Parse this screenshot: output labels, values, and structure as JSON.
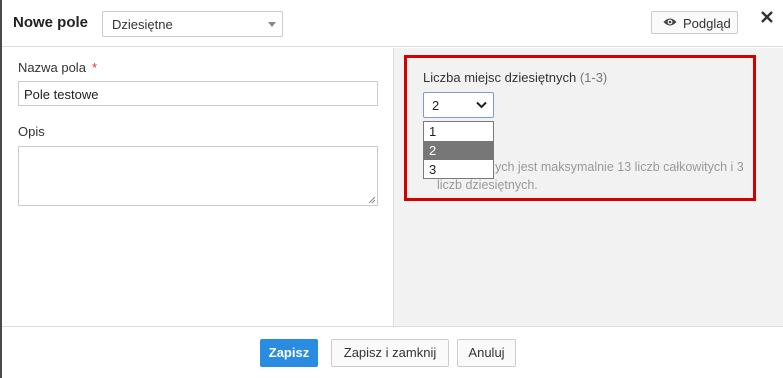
{
  "header": {
    "title": "Nowe pole",
    "field_type": "Dziesiętne",
    "preview_label": "Podgląd"
  },
  "left": {
    "name_label": "Nazwa pola",
    "required_mark": "*",
    "name_value": "Pole testowe",
    "description_label": "Opis",
    "description_value": ""
  },
  "right": {
    "decimal_label": "Liczba miejsc dziesiętnych",
    "decimal_range": "(1-3)",
    "decimal_selected": "2",
    "decimal_options": [
      "1",
      "2",
      "3"
    ],
    "info_line1": "ych jest maksymalnie 13 liczb całkowitych i 3",
    "info_line2": "liczb dziesiętnych.",
    "highlight_color": "#d40000"
  },
  "footer": {
    "save": "Zapisz",
    "save_close": "Zapisz i zamknij",
    "cancel": "Anuluj"
  },
  "colors": {
    "primary": "#2a8ce0",
    "required": "#e03030",
    "selected_option": "#777777"
  }
}
